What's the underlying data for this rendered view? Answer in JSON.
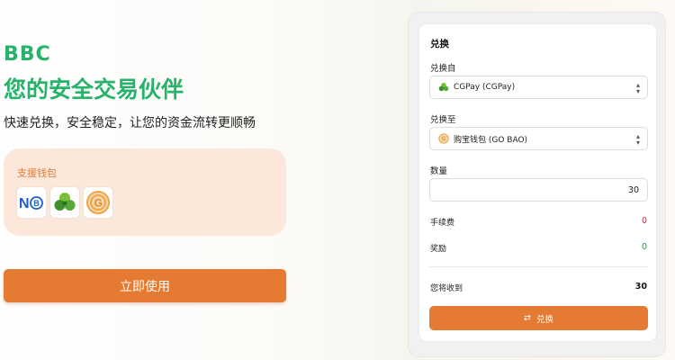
{
  "hero": {
    "brand": "BBC",
    "tagline": "您的安全交易伙伴",
    "subtitle": "快速兑换，安全稳定，让您的资金流转更顺畅"
  },
  "wallets": {
    "title": "支援钱包",
    "items": [
      {
        "name": "nb-wallet-icon"
      },
      {
        "name": "cgpay-wallet-icon"
      },
      {
        "name": "gobao-wallet-icon"
      }
    ]
  },
  "cta": {
    "label": "立即使用"
  },
  "exchange": {
    "title": "兑换",
    "from_label": "兑换自",
    "from_value": "CGPay (CGPay)",
    "to_label": "兑换至",
    "to_value": "购宝钱包 (GO BAO)",
    "qty_label": "数量",
    "qty_value": "30",
    "fee_label": "手续费",
    "fee_value": "0",
    "reward_label": "奖励",
    "reward_value": "0",
    "receive_label": "您将收到",
    "receive_value": "30",
    "button_label": "兑换",
    "colors": {
      "fee": "#d32f2f",
      "reward": "#2e9e4a",
      "accent": "#e57a33"
    }
  }
}
